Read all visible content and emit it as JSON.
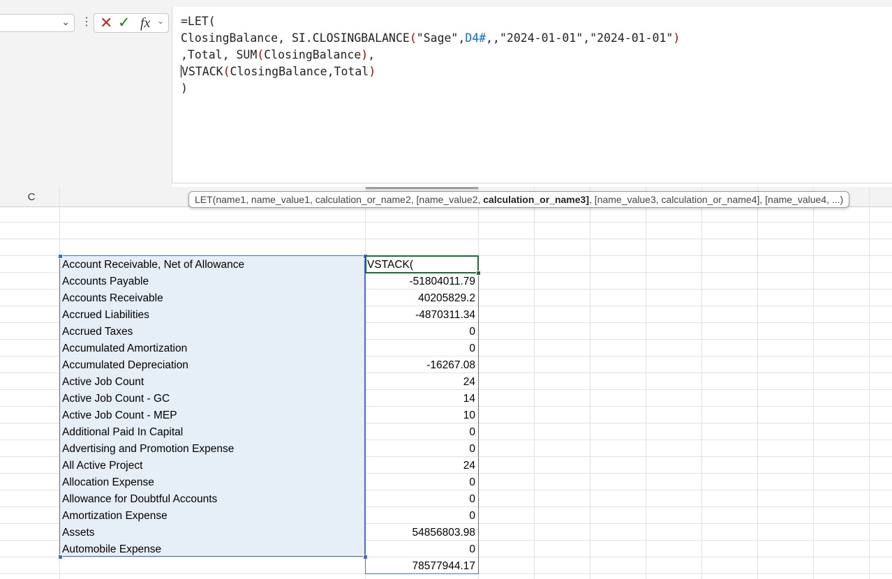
{
  "formula_bar": {
    "namebox_value": "",
    "dropdown_icon": "chevron-down-icon",
    "more_icon": "vertical-ellipsis-icon",
    "cancel_icon": "x-icon",
    "enter_icon": "checkmark-icon",
    "fx_label": "fx",
    "lines": [
      {
        "segments": [
          {
            "t": "=LET(",
            "c": ""
          }
        ]
      },
      {
        "segments": [
          {
            "t": "ClosingBalance, SI.CLOSINGBALANCE",
            "c": ""
          },
          {
            "t": "(",
            "c": "red"
          },
          {
            "t": "\"Sage\",",
            "c": ""
          },
          {
            "t": "D4#",
            "c": "blue"
          },
          {
            "t": ",,\"2024-01-01\",\"2024-01-01\"",
            "c": ""
          },
          {
            "t": ")",
            "c": "red"
          }
        ]
      },
      {
        "segments": [
          {
            "t": ",Total, SUM",
            "c": ""
          },
          {
            "t": "(",
            "c": "red"
          },
          {
            "t": "ClosingBalance",
            "c": ""
          },
          {
            "t": ")",
            "c": "red"
          },
          {
            "t": ",",
            "c": ""
          }
        ]
      },
      {
        "segments": [
          {
            "t": "",
            "c": "cursor"
          },
          {
            "t": "VSTACK",
            "c": ""
          },
          {
            "t": "(",
            "c": "red"
          },
          {
            "t": "ClosingBalance,Total",
            "c": ""
          },
          {
            "t": ")",
            "c": "red"
          }
        ]
      },
      {
        "segments": [
          {
            "t": ")",
            "c": ""
          }
        ]
      }
    ]
  },
  "grid": {
    "column_header": "C",
    "tooltip": {
      "prefix": "LET(name1, name_value1, calculation_or_name2, [name_value2, ",
      "bold": "calculation_or_name3]",
      "suffix": ", [name_value3, calculation_or_name4], [name_value4, ...)"
    },
    "active_cell_text": "VSTACK(",
    "labels": [
      "Account Receivable, Net of Allowance",
      "Accounts Payable",
      "Accounts Receivable",
      "Accrued Liabilities",
      "Accrued Taxes",
      "Accumulated Amortization",
      "Accumulated Depreciation",
      "Active Job Count",
      "Active Job Count - GC",
      "Active Job Count - MEP",
      "Additional Paid In Capital",
      "Advertising and Promotion Expense",
      "All Active Project",
      "Allocation Expense",
      "Allowance for Doubtful Accounts",
      "Amortization Expense",
      "Assets",
      "Automobile Expense"
    ],
    "values": [
      "-51804011.79",
      "40205829.2",
      "-4870311.34",
      "0",
      "0",
      "-16267.08",
      "24",
      "14",
      "10",
      "0",
      "0",
      "24",
      "0",
      "0",
      "0",
      "54856803.98",
      "0",
      "78577944.17"
    ]
  },
  "colors": {
    "selection_fill": "#e6eef8",
    "selection_border": "#3b6fc0",
    "active_cell_border": "#1d6b38",
    "paren_color": "#c00000",
    "reference_color": "#0b6fd0"
  }
}
